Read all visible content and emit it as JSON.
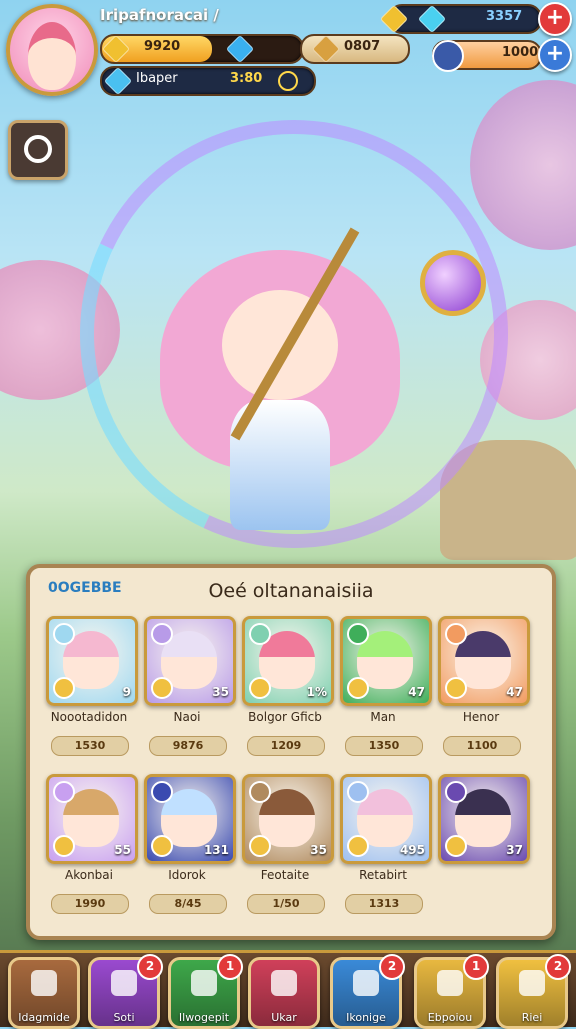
{
  "player": {
    "name": "Iripafnoracai /"
  },
  "resources": {
    "gold": "9920",
    "coins": "0807",
    "gems_top": "3357",
    "stamina": "1000",
    "ticket_label": "Ibaper",
    "ticket_value": "3:80"
  },
  "panel": {
    "title": "Oeé oltananaisiia",
    "counter": "0OGEBBE"
  },
  "cards": [
    {
      "name": "Noootadidon",
      "level": "9",
      "value": "1530",
      "bg": "#9fd8f0",
      "hair": "#f5b8d0"
    },
    {
      "name": "Naoi",
      "level": "35",
      "value": "9876",
      "bg": "#b89be8",
      "hair": "#e9e0f5"
    },
    {
      "name": "Bolgor Gficb",
      "level": "1%",
      "value": "1209",
      "bg": "#7fd0b0",
      "hair": "#f07a9a"
    },
    {
      "name": "Man",
      "level": "47",
      "value": "1350",
      "bg": "#3fae5a",
      "hair": "#a4f07a"
    },
    {
      "name": "Henor",
      "level": "47",
      "value": "1100",
      "bg": "#f29b60",
      "hair": "#4a3a6a"
    },
    {
      "name": "Akonbai",
      "level": "55",
      "value": "1990",
      "bg": "#c8a0f0",
      "hair": "#d8a86a"
    },
    {
      "name": "Idorok",
      "level": "131",
      "value": "8/45",
      "bg": "#3a4ab0",
      "hair": "#c0e0ff"
    },
    {
      "name": "Feotaite",
      "level": "35",
      "value": "1/50",
      "bg": "#b08a5e",
      "hair": "#8a5a3a"
    },
    {
      "name": "Retabirt",
      "level": "495",
      "value": "1313",
      "bg": "#9ec0f0",
      "hair": "#f2c0dc"
    },
    {
      "name": "",
      "level": "37",
      "value": "",
      "bg": "#6a4ab0",
      "hair": "#3a3050"
    }
  ],
  "nav": [
    {
      "label": "Idagmide",
      "badge": "",
      "color": "#a86a3e",
      "icon": "home-icon"
    },
    {
      "label": "Soti",
      "badge": "2",
      "color": "#9a4ad0",
      "icon": "card-icon"
    },
    {
      "label": "Ilwogepit",
      "badge": "1",
      "color": "#3ea84a",
      "icon": "check-icon"
    },
    {
      "label": "Ukar",
      "badge": "",
      "color": "#d0405a",
      "icon": "swap-icon"
    },
    {
      "label": "Ikonige",
      "badge": "2",
      "color": "#3a8ad8",
      "icon": "puzzle-icon"
    },
    {
      "label": "Ebpoiou",
      "badge": "1",
      "color": "#e8b840",
      "icon": "inventory-icon"
    },
    {
      "label": "Riei",
      "badge": "2",
      "color": "#f0c040",
      "icon": "star-icon"
    }
  ]
}
